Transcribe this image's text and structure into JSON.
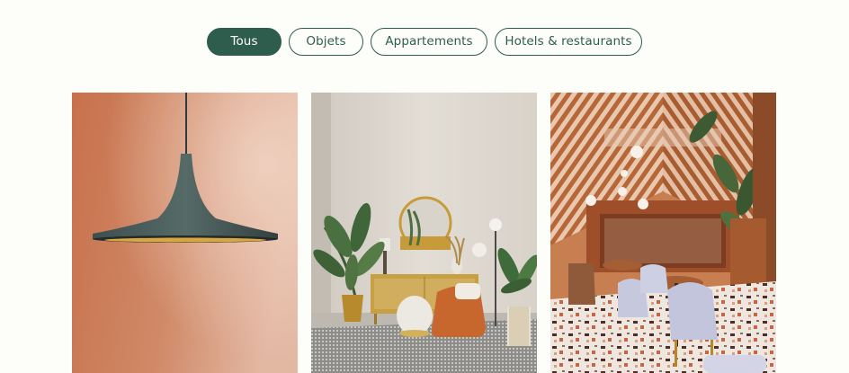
{
  "filters": [
    {
      "label": "Tous",
      "active": true
    },
    {
      "label": "Objets",
      "active": false
    },
    {
      "label": "Appartements",
      "active": false
    },
    {
      "label": "Hotels & restaurants",
      "active": false
    }
  ],
  "colors": {
    "accent": "#2e5d4e",
    "background": "#fdfdf9"
  },
  "gallery": [
    {
      "name": "pendant-lamp-photo"
    },
    {
      "name": "living-room-photo"
    },
    {
      "name": "restaurant-photo"
    }
  ]
}
